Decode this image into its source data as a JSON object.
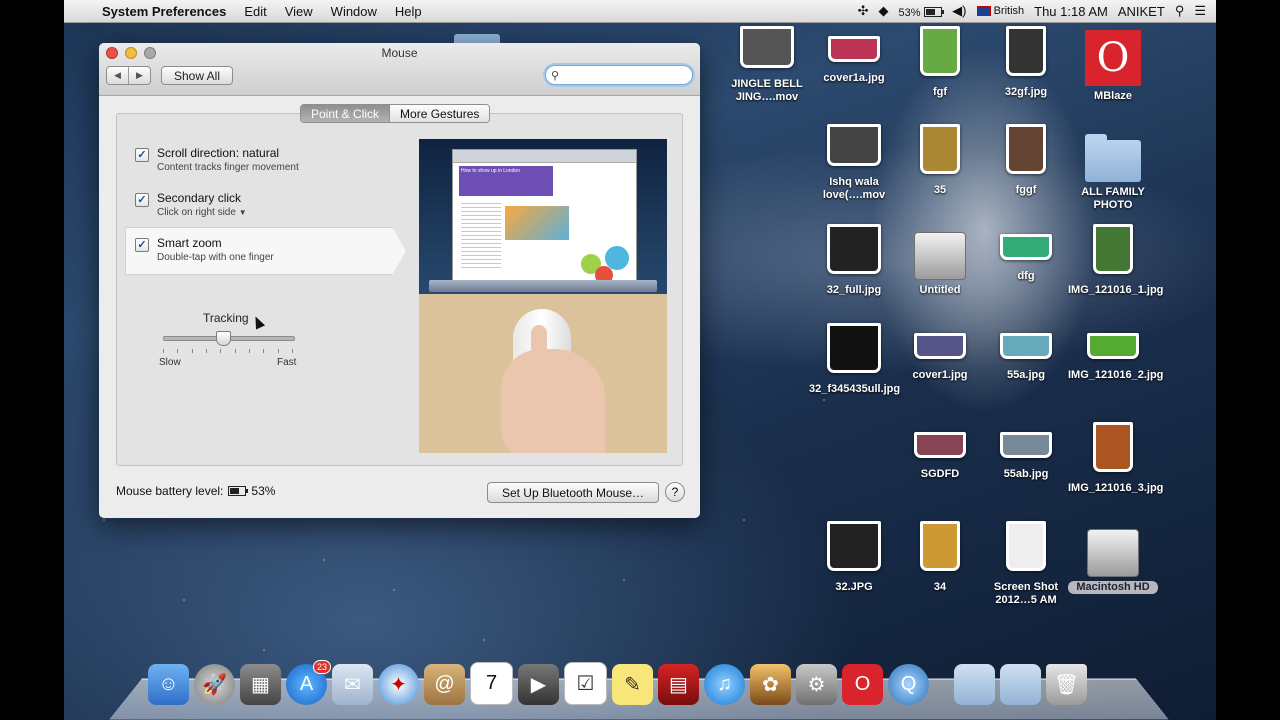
{
  "menubar": {
    "app_name": "System Preferences",
    "menus": [
      "Edit",
      "View",
      "Window",
      "Help"
    ],
    "battery_percent": "53%",
    "input_source": "British",
    "clock": "Thu 1:18 AM",
    "user": "ANIKET"
  },
  "window": {
    "title": "Mouse",
    "show_all_label": "Show All",
    "search_placeholder": "",
    "tabs": [
      {
        "label": "Point & Click",
        "active": true
      },
      {
        "label": "More Gestures",
        "active": false
      }
    ],
    "options": [
      {
        "title": "Scroll direction: natural",
        "subtitle": "Content tracks finger movement",
        "checked": true
      },
      {
        "title": "Secondary click",
        "subtitle": "Click on right side",
        "checked": true
      },
      {
        "title": "Smart zoom",
        "subtitle": "Double-tap with one finger",
        "checked": true
      }
    ],
    "tracking": {
      "label": "Tracking",
      "min_label": "Slow",
      "max_label": "Fast",
      "level": 0.45
    },
    "battery_label": "Mouse battery level:",
    "battery_value": "53%",
    "setup_button": "Set Up Bluetooth Mouse…",
    "help_label": "?",
    "preview_page_title": "How to show up in London"
  },
  "desktop_icons": [
    {
      "label": "JINGLE BELL JING….mov",
      "kind": "video"
    },
    {
      "label": "cover1a.jpg",
      "kind": "image"
    },
    {
      "label": "fgf",
      "kind": "image"
    },
    {
      "label": "32gf.jpg",
      "kind": "image"
    },
    {
      "label": "MBlaze",
      "kind": "app"
    },
    {
      "label": "Ishq wala love(….mov",
      "kind": "video"
    },
    {
      "label": "35",
      "kind": "image"
    },
    {
      "label": "fggf",
      "kind": "image"
    },
    {
      "label": "ALL  FAMILY PHOTO",
      "kind": "folder"
    },
    {
      "label": "32_full.jpg",
      "kind": "image"
    },
    {
      "label": "Untitled",
      "kind": "drive"
    },
    {
      "label": "dfg",
      "kind": "image"
    },
    {
      "label": "IMG_121016_1.jpg",
      "kind": "image"
    },
    {
      "label": "32_f345435ull.jpg",
      "kind": "image"
    },
    {
      "label": "cover1.jpg",
      "kind": "image"
    },
    {
      "label": "55a.jpg",
      "kind": "image"
    },
    {
      "label": "IMG_121016_2.jpg",
      "kind": "image"
    },
    {
      "label": "SGDFD",
      "kind": "image"
    },
    {
      "label": "55ab.jpg",
      "kind": "image"
    },
    {
      "label": "IMG_121016_3.jpg",
      "kind": "image"
    },
    {
      "label": "32.JPG",
      "kind": "image"
    },
    {
      "label": "34",
      "kind": "image"
    },
    {
      "label": "Screen Shot 2012…5 AM",
      "kind": "image"
    },
    {
      "label": "Macintosh HD",
      "kind": "drive"
    }
  ],
  "dock": {
    "app_store_badge": "23",
    "calendar_day": "7",
    "apps": [
      "finder",
      "launchpad",
      "photo-browser",
      "app-store",
      "mail",
      "safari",
      "contacts",
      "calendar",
      "facetime",
      "reminders",
      "notes",
      "photo-booth",
      "itunes",
      "iphoto",
      "system-preferences",
      "mblaze",
      "quicktime",
      "documents",
      "downloads",
      "trash"
    ]
  }
}
